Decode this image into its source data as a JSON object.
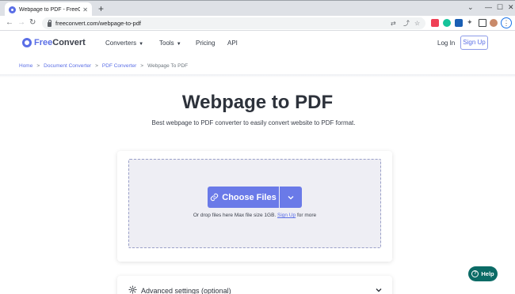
{
  "browser": {
    "tab_title": "Webpage to PDF - FreeConvert.c",
    "tab_close": "✕",
    "new_tab": "+",
    "url": "freeconvert.com/webpage-to-pdf",
    "window_controls": {
      "chevron": "⌄",
      "minimize": "—",
      "maximize": "☐",
      "close": "✕"
    },
    "extensions": [
      {
        "name": "pocket-icon",
        "color": "#ef4056"
      },
      {
        "name": "grammarly-icon",
        "color": "#15c39a"
      },
      {
        "name": "tab-manager-icon",
        "color": "#1a5fb4"
      },
      {
        "name": "translate-extension-icon",
        "color": "#2c7be5"
      }
    ]
  },
  "site": {
    "logo_free": "Free",
    "logo_convert": "Convert",
    "nav": [
      {
        "label": "Converters",
        "caret": "▼"
      },
      {
        "label": "Tools",
        "caret": "▼"
      },
      {
        "label": "Pricing"
      },
      {
        "label": "API"
      }
    ],
    "login": "Log In",
    "signup": "Sign Up",
    "accent": "#5a6ee6"
  },
  "breadcrumb": [
    "Home",
    "Document Converter",
    "PDF Converter",
    "Webpage To PDF"
  ],
  "breadcrumb_sep": ">",
  "main": {
    "title": "Webpage to PDF",
    "subtitle": "Best webpage to PDF converter to easily convert website to PDF format.",
    "choose_files": "Choose Files",
    "drop_hint_prefix": "Or drop files here Max file size 1GB.",
    "drop_hint_link": "Sign Up",
    "drop_hint_suffix": "for more",
    "advanced_settings": "Advanced settings (optional)"
  },
  "help": {
    "label": "Help",
    "icon_glyph": "?",
    "color": "#0b6b66"
  }
}
